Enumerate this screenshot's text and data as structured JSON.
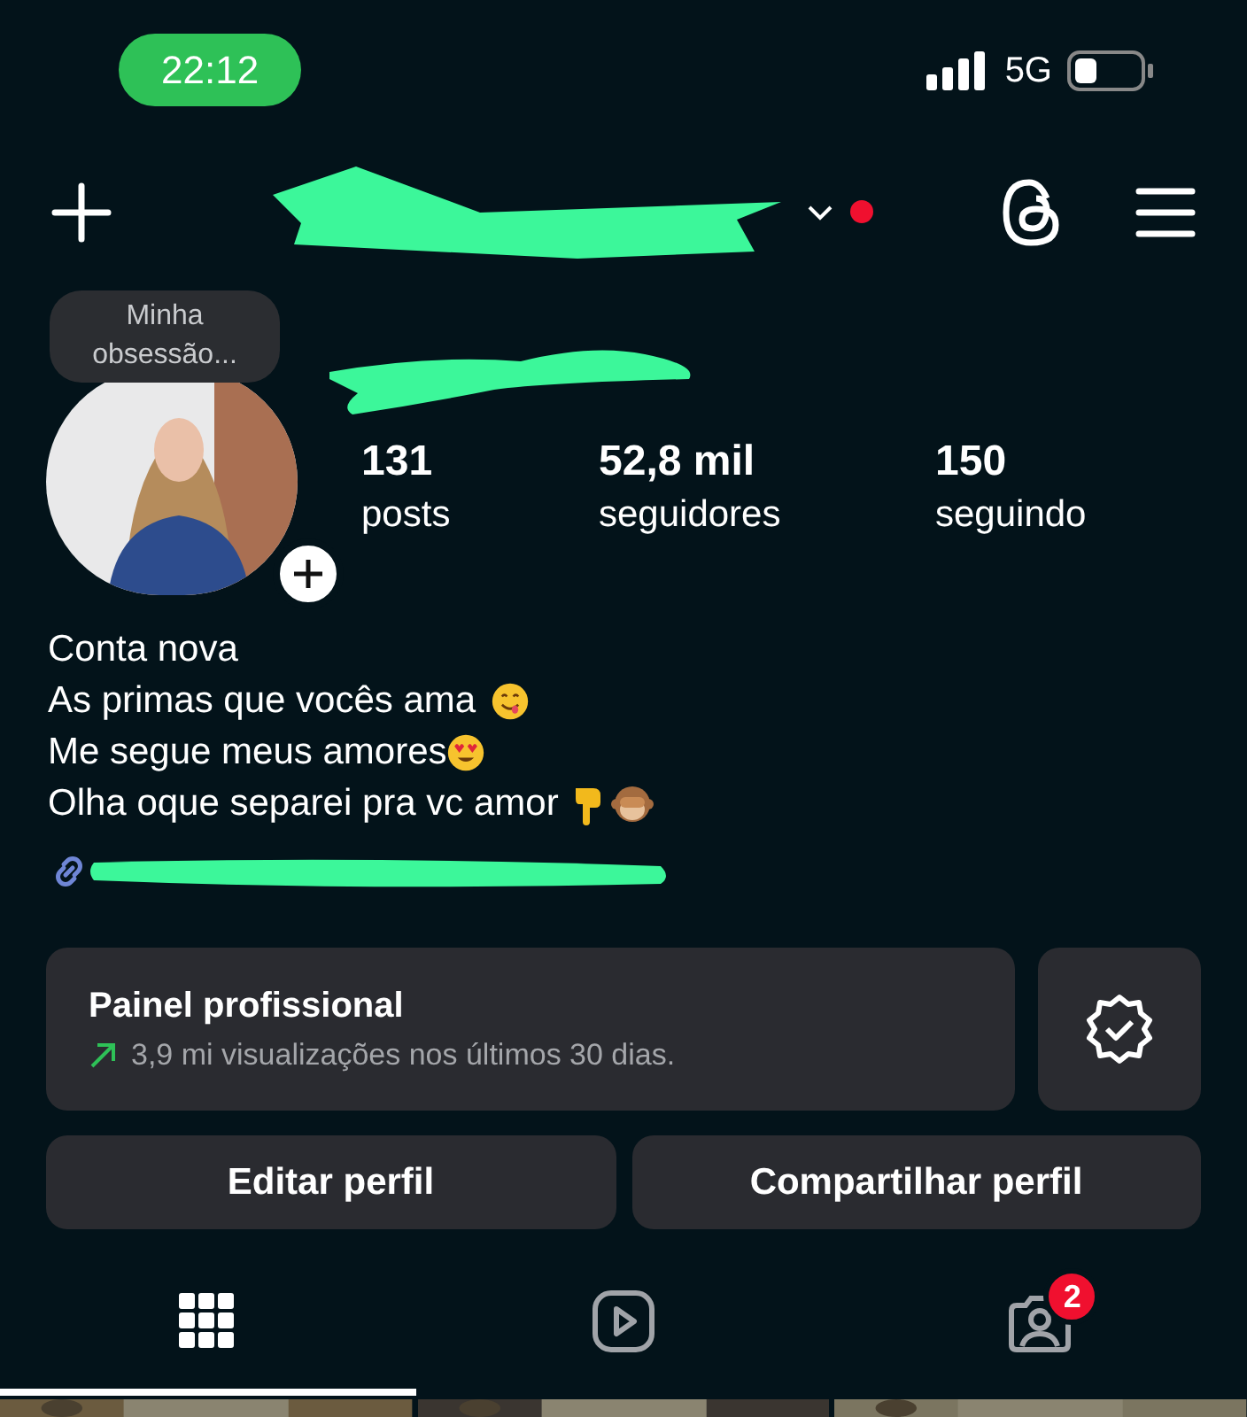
{
  "status_bar": {
    "time": "22:12",
    "network": "5G"
  },
  "header": {
    "has_notification_dot": true
  },
  "profile": {
    "note": "Minha obsessão...",
    "stats": [
      {
        "value": "131",
        "label": "posts"
      },
      {
        "value": "52,8 mil",
        "label": "seguidores"
      },
      {
        "value": "150",
        "label": "seguindo"
      }
    ],
    "bio": [
      {
        "text": "Conta nova"
      },
      {
        "text": "As primas que vocês ama",
        "emojis": [
          {
            "kind": "yum"
          }
        ]
      },
      {
        "text": "Me segue meus amores",
        "emojis": [
          {
            "kind": "heart-eyes"
          }
        ]
      },
      {
        "text": "Olha oque separei pra vc amor",
        "emojis": [
          {
            "kind": "point-down"
          },
          {
            "kind": "see-no-evil"
          }
        ]
      }
    ]
  },
  "dashboard": {
    "title": "Painel profissional",
    "subtitle": "3,9 mi visualizações nos últimos 30 dias."
  },
  "buttons": [
    "Editar perfil",
    "Compartilhar perfil"
  ],
  "tabs": [
    {
      "kind": "grid",
      "selected": true
    },
    {
      "kind": "reels",
      "selected": false
    },
    {
      "kind": "tagged",
      "selected": false,
      "badge": "2"
    }
  ]
}
